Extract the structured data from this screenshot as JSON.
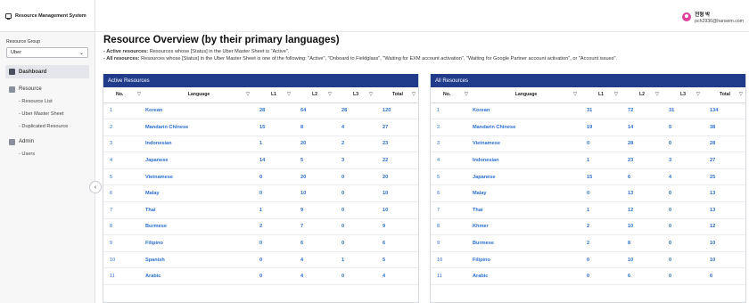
{
  "app": {
    "title": "Resource Management System"
  },
  "sidebar": {
    "group_label": "Resource Group",
    "group_value": "Uber",
    "items": [
      {
        "label": "Dashboard"
      },
      {
        "label": "Resource",
        "subs": [
          "Resource List",
          "Uber Master Sheet",
          "Duplicated Resource"
        ]
      },
      {
        "label": "Admin",
        "subs": [
          "Users"
        ]
      }
    ]
  },
  "user": {
    "name": "전형 박",
    "email": "pch2936@hansem.com"
  },
  "page": {
    "title": "Resource Overview (by their primary languages)",
    "desc_active_label": "- Active resources:",
    "desc_active_text": " Resources whose [Status] in the Uber Master Sheet is \"Active\".",
    "desc_all_label": "- All resources:",
    "desc_all_text": " Resources whose [Status] in the Uber Master Sheet is one of the following: \"Active\", \"Onboard to Fieldglass\", \"Waiting for EXM account activation\", \"Waiting for Google Partner account activation\", or \"Account issues\"."
  },
  "columns": [
    "No.",
    "Language",
    "L1",
    "L2",
    "L3",
    "Total"
  ],
  "active_panel": {
    "title": "Active Resources",
    "rows": [
      [
        "1",
        "Korean",
        "28",
        "64",
        "28",
        "120"
      ],
      [
        "2",
        "Mandarin Chinese",
        "15",
        "8",
        "4",
        "27"
      ],
      [
        "3",
        "Indonesian",
        "1",
        "20",
        "2",
        "23"
      ],
      [
        "4",
        "Japanese",
        "14",
        "5",
        "3",
        "22"
      ],
      [
        "5",
        "Vietnamese",
        "0",
        "20",
        "0",
        "20"
      ],
      [
        "6",
        "Malay",
        "0",
        "10",
        "0",
        "10"
      ],
      [
        "7",
        "Thai",
        "1",
        "9",
        "0",
        "10"
      ],
      [
        "8",
        "Burmese",
        "2",
        "7",
        "0",
        "9"
      ],
      [
        "9",
        "Filipino",
        "0",
        "6",
        "0",
        "6"
      ],
      [
        "10",
        "Spanish",
        "0",
        "4",
        "1",
        "5"
      ],
      [
        "11",
        "Arabic",
        "0",
        "4",
        "0",
        "4"
      ]
    ]
  },
  "all_panel": {
    "title": "All Resources",
    "rows": [
      [
        "1",
        "Korean",
        "31",
        "72",
        "31",
        "134"
      ],
      [
        "2",
        "Mandarin Chinese",
        "19",
        "14",
        "5",
        "38"
      ],
      [
        "3",
        "Vietnamese",
        "0",
        "28",
        "0",
        "28"
      ],
      [
        "4",
        "Indonesian",
        "1",
        "23",
        "3",
        "27"
      ],
      [
        "5",
        "Japanese",
        "15",
        "6",
        "4",
        "25"
      ],
      [
        "6",
        "Malay",
        "0",
        "13",
        "0",
        "13"
      ],
      [
        "7",
        "Thai",
        "1",
        "12",
        "0",
        "13"
      ],
      [
        "8",
        "Khmer",
        "2",
        "10",
        "0",
        "12"
      ],
      [
        "9",
        "Burmese",
        "2",
        "8",
        "0",
        "10"
      ],
      [
        "10",
        "Filipino",
        "0",
        "10",
        "0",
        "10"
      ],
      [
        "11",
        "Arabic",
        "0",
        "6",
        "0",
        "6"
      ]
    ]
  },
  "icons": {
    "filter": "filter-icon",
    "collapse": "chevron-left-icon",
    "select": "chevron-down-icon"
  }
}
